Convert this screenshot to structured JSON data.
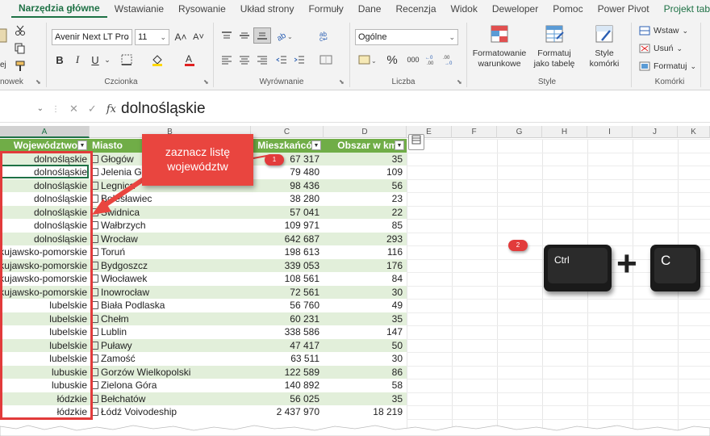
{
  "ribbon": {
    "tabs": [
      "Narzędzia główne",
      "Wstawianie",
      "Rysowanie",
      "Układ strony",
      "Formuły",
      "Dane",
      "Recenzja",
      "Widok",
      "Deweloper",
      "Pomoc",
      "Power Pivot",
      "Projekt tabeli"
    ],
    "clipboard": {
      "paste_label": "ej",
      "group_label": "nowek"
    },
    "font": {
      "font_name": "Avenir Next LT Pro",
      "font_size": "11",
      "grow": "A˄",
      "shrink": "A˅",
      "bold": "B",
      "italic": "I",
      "underline": "U",
      "group_label": "Czcionka"
    },
    "alignment": {
      "group_label": "Wyrównanie"
    },
    "number": {
      "format": "Ogólne",
      "percent": "%",
      "thousands": "000",
      "group_label": "Liczba"
    },
    "styles": {
      "conditional": "Formatowanie warunkowe",
      "format_table": "Formatuj jako tabelę",
      "cell_styles": "Style komórki",
      "group_label": "Style"
    },
    "cells": {
      "insert": "Wstaw",
      "delete": "Usuń",
      "format": "Formatuj",
      "group_label": "Komórki"
    }
  },
  "formula_bar": {
    "fx": "fx",
    "value": "dolnośląskie"
  },
  "columns": [
    "A",
    "B",
    "C",
    "D",
    "E",
    "F",
    "G",
    "H",
    "I",
    "J",
    "K"
  ],
  "table": {
    "headers": [
      "Województwo",
      "Miasto",
      "Mieszkańców",
      "Obszar w km2"
    ],
    "rows": [
      [
        "dolnośląskie",
        "Głogów",
        "67 317",
        "35"
      ],
      [
        "dolnośląskie",
        "Jelenia Góra",
        "79 480",
        "109"
      ],
      [
        "dolnośląskie",
        "Legnica",
        "98 436",
        "56"
      ],
      [
        "dolnośląskie",
        "Bolesławiec",
        "38 280",
        "23"
      ],
      [
        "dolnośląskie",
        "Świdnica",
        "57 041",
        "22"
      ],
      [
        "dolnośląskie",
        "Wałbrzych",
        "109 971",
        "85"
      ],
      [
        "dolnośląskie",
        "Wrocław",
        "642 687",
        "293"
      ],
      [
        "kujawsko-pomorskie",
        "Toruń",
        "198 613",
        "116"
      ],
      [
        "kujawsko-pomorskie",
        "Bydgoszcz",
        "339 053",
        "176"
      ],
      [
        "kujawsko-pomorskie",
        "Włocławek",
        "108 561",
        "84"
      ],
      [
        "kujawsko-pomorskie",
        "Inowrocław",
        "72 561",
        "30"
      ],
      [
        "lubelskie",
        "Biała Podlaska",
        "56 760",
        "49"
      ],
      [
        "lubelskie",
        "Chełm",
        "60 231",
        "35"
      ],
      [
        "lubelskie",
        "Lublin",
        "338 586",
        "147"
      ],
      [
        "lubelskie",
        "Puławy",
        "47 417",
        "50"
      ],
      [
        "lubelskie",
        "Zamość",
        "63 511",
        "30"
      ],
      [
        "lubuskie",
        "Gorzów Wielkopolski",
        "122 589",
        "86"
      ],
      [
        "lubuskie",
        "Zielona Góra",
        "140 892",
        "58"
      ],
      [
        "łódzkie",
        "Bełchatów",
        "56 025",
        "35"
      ],
      [
        "łódzkie",
        "Łódź Voivodeship",
        "2 437 970",
        "18 219"
      ]
    ]
  },
  "annotations": {
    "callout_text": "zaznacz listę województw",
    "badge1": "1",
    "badge2": "2",
    "key_ctrl": "Ctrl",
    "key_c": "C",
    "plus": "+"
  },
  "colors": {
    "excel_green": "#1e7145",
    "table_header": "#70ad47",
    "band": "#e2efda",
    "callout": "#e9453f"
  }
}
